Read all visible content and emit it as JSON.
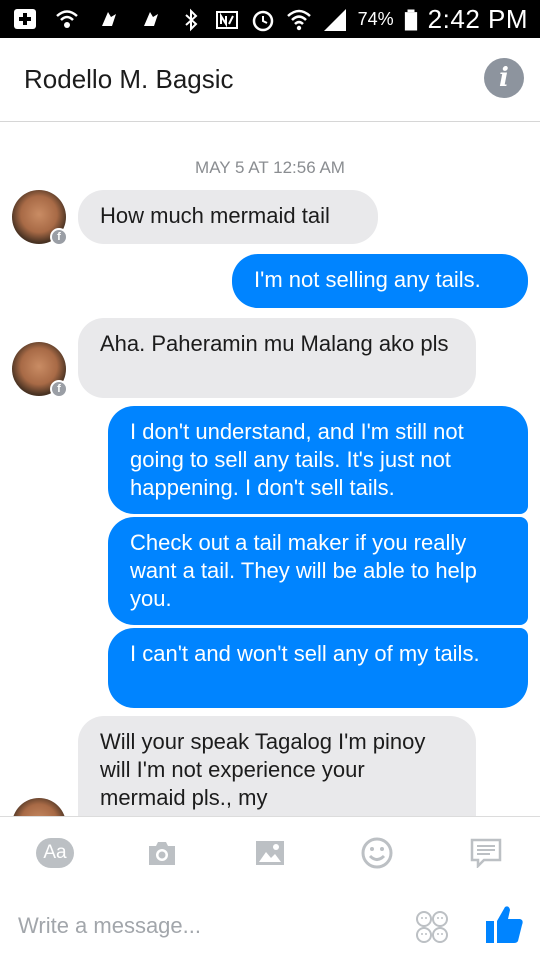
{
  "status_bar": {
    "battery_percent": "74%",
    "time": "2:42 PM"
  },
  "header": {
    "contact_name": "Rodello M. Bagsic",
    "info_icon": "info-icon"
  },
  "conversation": {
    "timestamp": "MAY 5 AT 12:56 AM",
    "messages": [
      {
        "sender": "them",
        "text": "How much mermaid tail"
      },
      {
        "sender": "me",
        "text": "I'm not selling any tails."
      },
      {
        "sender": "them",
        "text": "Aha. Paheramin mu Malang ako pls"
      },
      {
        "sender": "me",
        "text": "I don't understand, and I'm still not going to sell any tails. It's just not happening. I don't sell tails."
      },
      {
        "sender": "me",
        "text": "Check out a tail maker if you really want a tail. They will be able to help you."
      },
      {
        "sender": "me",
        "text": "I can't and won't sell any of my tails."
      },
      {
        "sender": "them",
        "text": "Will your speak Tagalog I'm pinoy will I'm not experience your mermaid pls., my"
      }
    ]
  },
  "composer": {
    "aa_label": "Aa",
    "placeholder": "Write a message...",
    "tools": [
      "text-format-icon",
      "camera-icon",
      "photo-icon",
      "emoji-icon",
      "chat-icon"
    ],
    "accent_color": "#0084ff"
  }
}
